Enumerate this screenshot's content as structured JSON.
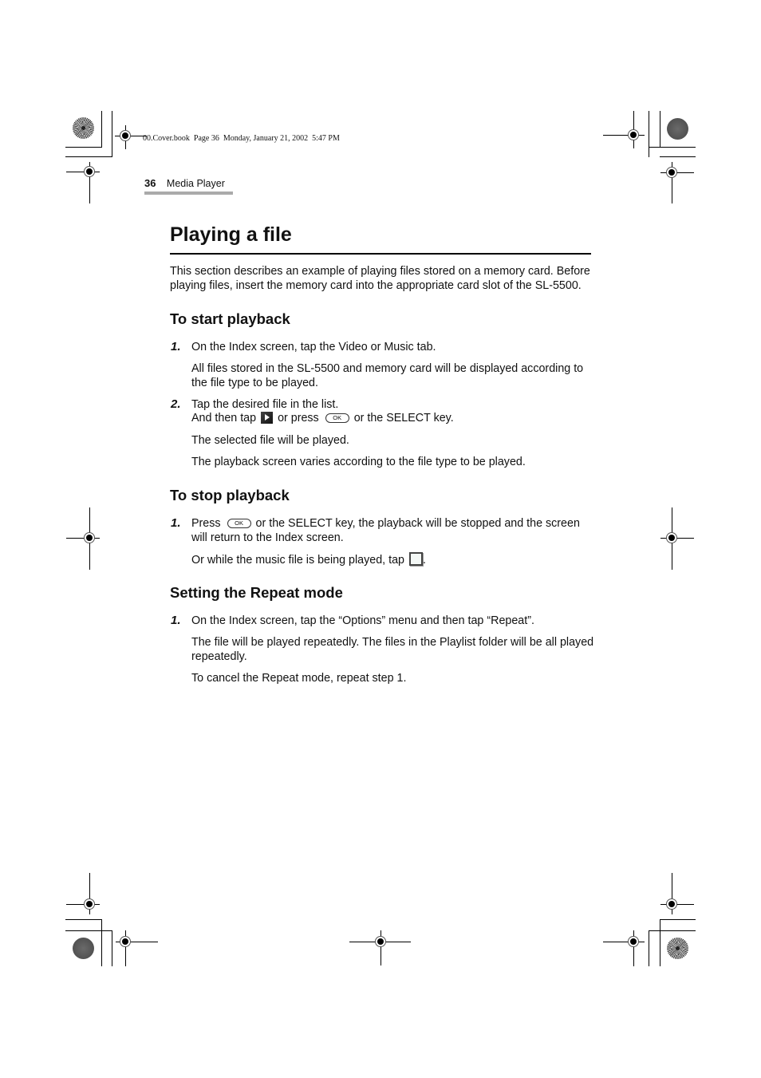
{
  "print_info": "00.Cover.book  Page 36  Monday, January 21, 2002  5:47 PM",
  "header": {
    "page_number": "36",
    "section": "Media Player"
  },
  "title": "Playing a file",
  "intro": [
    "This section describes an example of playing files stored on a memory card. Before",
    "playing files, insert the memory card into the appropriate card slot of the SL-5500."
  ],
  "sections": {
    "start": {
      "heading": "To start playback",
      "step1": {
        "num": "1.",
        "text": "On the Index screen, tap the Video or Music tab.",
        "note1": "All files stored in the SL-5500 and memory card will be displayed according to",
        "note2": "the file type to be played."
      },
      "step2": {
        "num": "2.",
        "text": "Tap the desired file in the list.",
        "line2_a": "And then tap",
        "line2_b": "or press",
        "line2_c": "or the SELECT key.",
        "ok_label": "OK",
        "note1": "The selected file will be played.",
        "note2": "The playback screen varies according to the file type to be played."
      }
    },
    "stop": {
      "heading": "To stop playback",
      "step1": {
        "num": "1.",
        "text_a": "Press",
        "ok_label": "OK",
        "text_b": "or the SELECT key, the playback will be stopped and the screen",
        "text_c": "will return to the Index screen.",
        "note_a": "Or while the music file is being played, tap",
        "note_b": "."
      }
    },
    "repeat": {
      "heading": "Setting the Repeat mode",
      "step1": {
        "num": "1.",
        "text": "On the Index screen, tap the “Options” menu and then tap “Repeat”.",
        "note1": "The file will be played repeatedly. The files in the Playlist folder will be all played",
        "note2": "repeatedly.",
        "note3": "To cancel the Repeat mode, repeat step 1."
      }
    }
  }
}
